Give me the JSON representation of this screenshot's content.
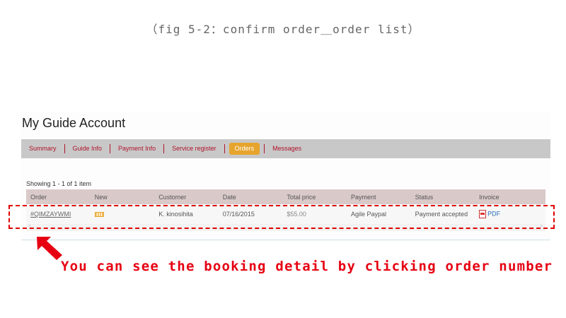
{
  "caption": "（fig 5-2：confirm order＿order list）",
  "account": {
    "title": "My Guide Account"
  },
  "tabs": [
    {
      "label": "Summary"
    },
    {
      "label": "Guide Info"
    },
    {
      "label": "Payment Info"
    },
    {
      "label": "Service register"
    },
    {
      "label": "Orders",
      "active": true
    },
    {
      "label": "Messages"
    }
  ],
  "listing": {
    "showing": "Showing 1 - 1 of 1 item"
  },
  "table": {
    "headers": [
      "Order",
      "New",
      "Customer",
      "Date",
      "Total price",
      "Payment",
      "Status",
      "Invoice"
    ],
    "rows": [
      {
        "order": "#QIMZAYWMI",
        "new_icon": "new-badge-icon",
        "customer": "K. kinosihita",
        "date": "07/16/2015",
        "total_price": "$55.00",
        "payment": "Agile Paypal",
        "status": "Payment accepted",
        "invoice": "PDF",
        "invoice_icon": "pdf-icon"
      }
    ]
  },
  "annotation": "You can see the booking detail by clicking order number",
  "colors": {
    "tab_text": "#b0132b",
    "tab_active_bg": "#e7a42d",
    "annotation": "#e60012",
    "table_header_bg": "#d9c9c9",
    "tabbar_bg": "#c8c8c8"
  }
}
